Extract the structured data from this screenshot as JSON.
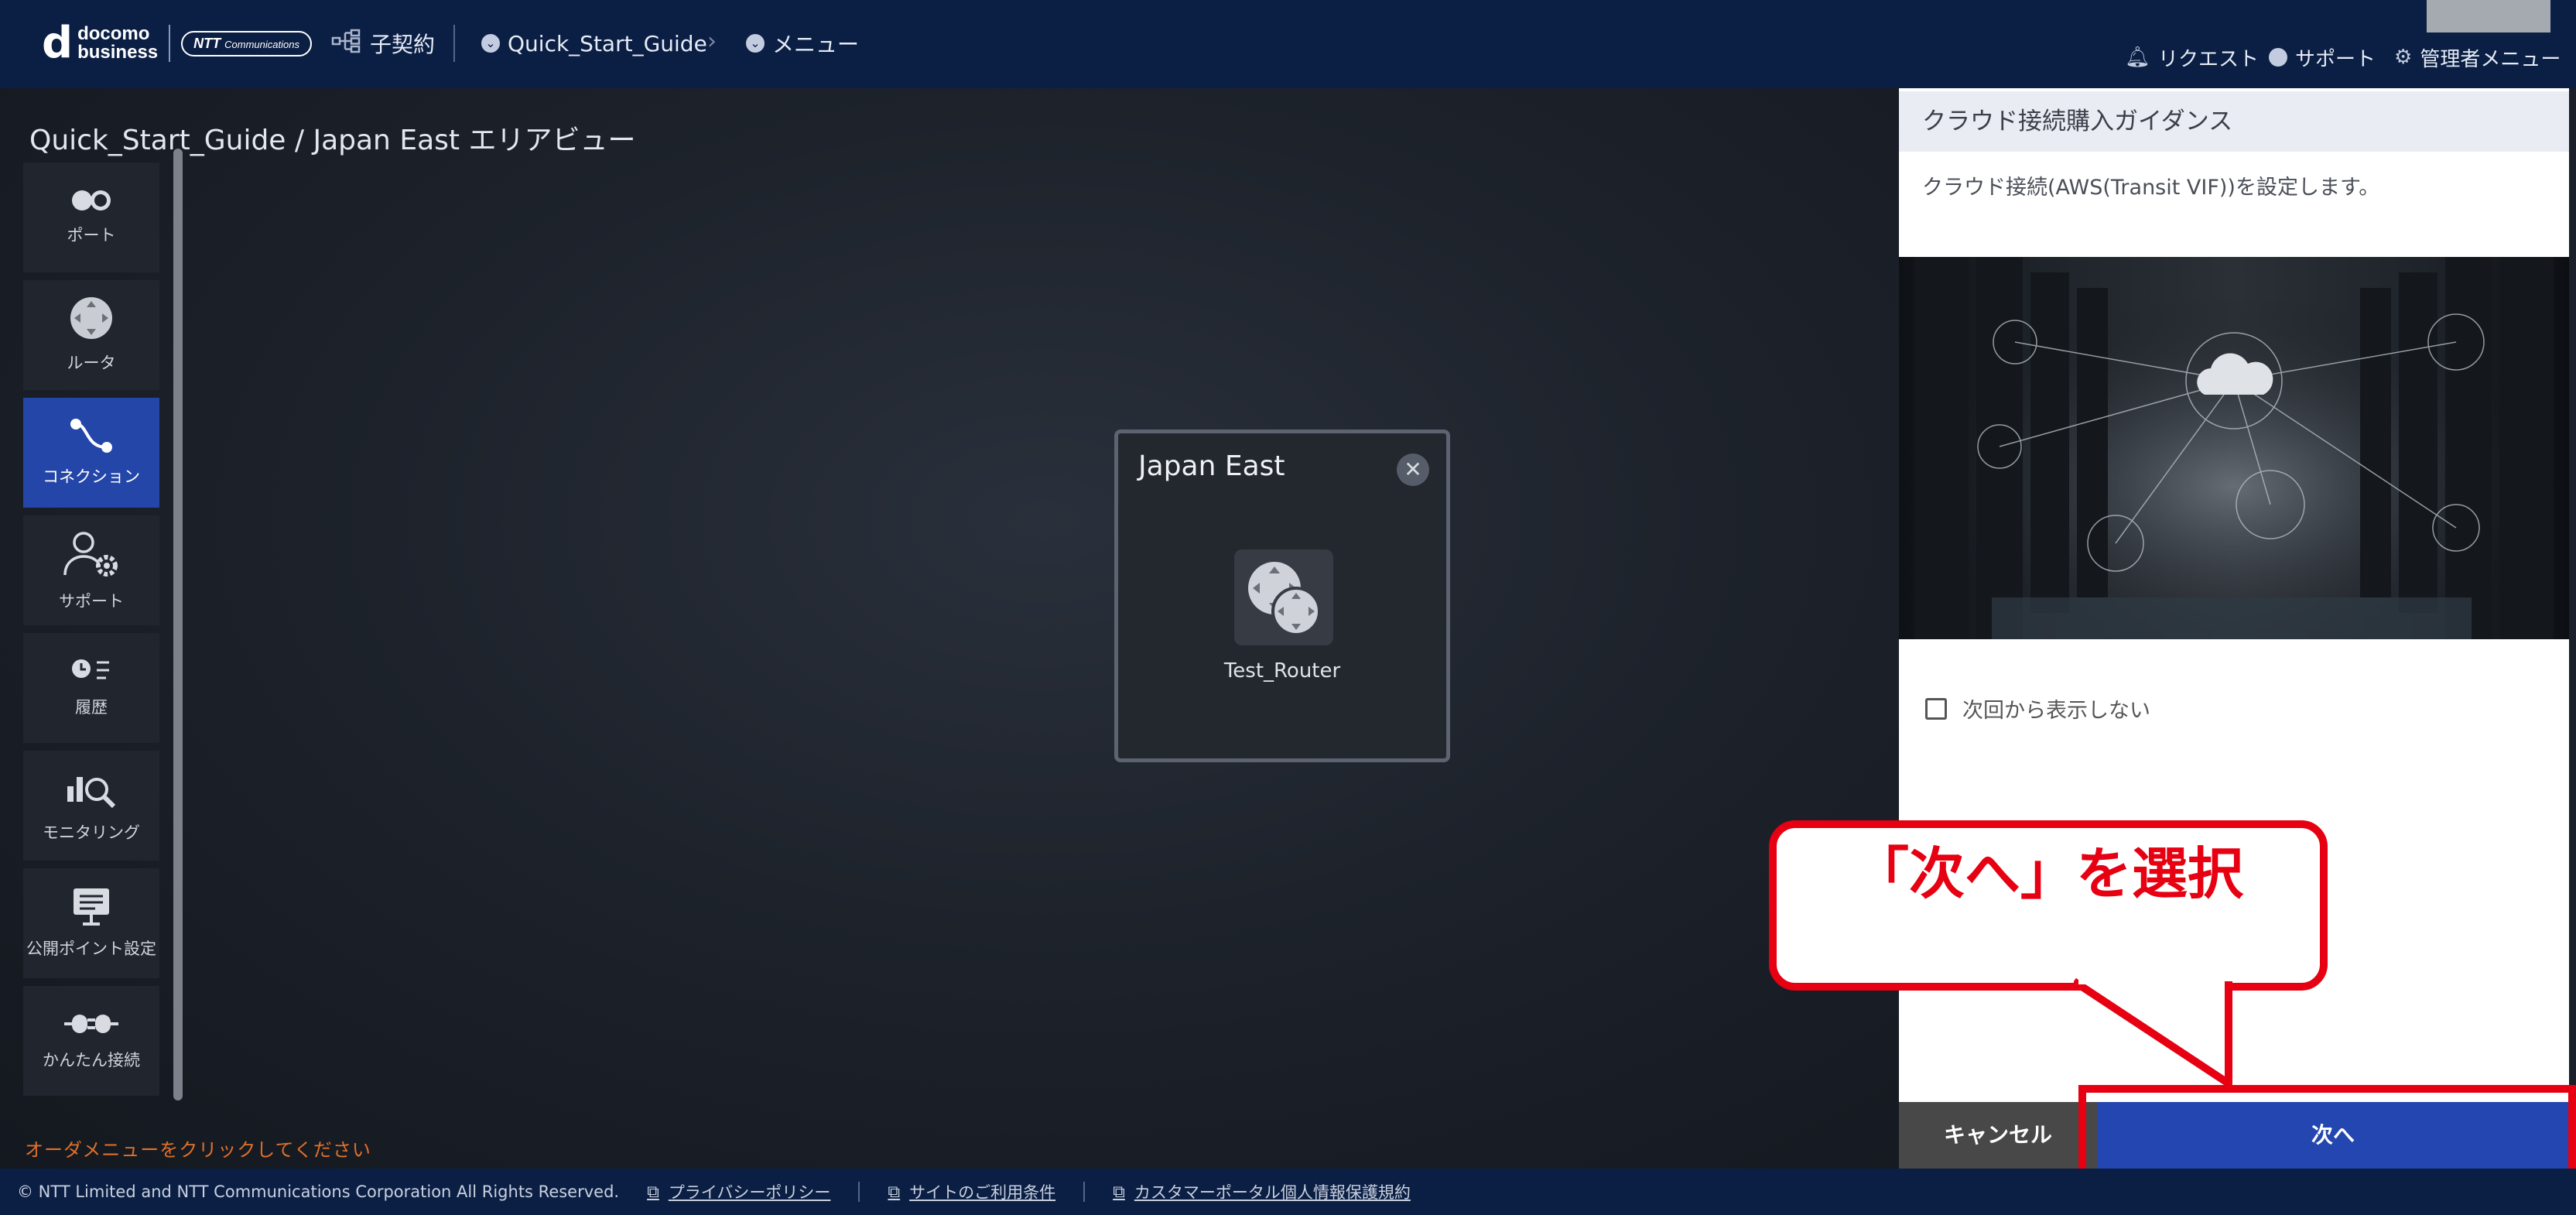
{
  "header": {
    "logo_top": "docomo",
    "logo_bottom": "business",
    "ntt_text": "NTT",
    "ntt_sub": "Communications",
    "contract_label": "子契約",
    "breadcrumb": {
      "project": "Quick_Start_Guide",
      "menu": "メニュー"
    },
    "right_links": {
      "request": "リクエスト",
      "support": "サポート",
      "admin": "管理者メニュー"
    }
  },
  "main": {
    "page_title": "Quick_Start_Guide / Japan East エリアビュー",
    "sidebar": [
      {
        "label": "ポート",
        "icon": "port-icon"
      },
      {
        "label": "ルータ",
        "icon": "router-icon"
      },
      {
        "label": "コネクション",
        "icon": "connection-icon",
        "active": true
      },
      {
        "label": "サポート",
        "icon": "support-icon"
      },
      {
        "label": "履歴",
        "icon": "history-icon"
      },
      {
        "label": "モニタリング",
        "icon": "monitoring-icon"
      },
      {
        "label": "公開ポイント設定",
        "icon": "public-point-icon"
      },
      {
        "label": "かんたん接続",
        "icon": "easy-connect-icon"
      }
    ],
    "order_hint": "オーダメニューをクリックしてください",
    "area": {
      "title": "Japan East",
      "close": "✕",
      "router_name": "Test_Router"
    }
  },
  "panel": {
    "title": "クラウド接続購入ガイダンス",
    "description": "クラウド接続(AWS(Transit VIF))を設定します。",
    "dont_show_label": "次回から表示しない",
    "cancel_label": "キャンセル",
    "next_label": "次へ"
  },
  "annotation": {
    "callout_text": "「次へ」を選択",
    "accent_color": "#e60012"
  },
  "footer": {
    "copyright": "© NTT Limited and NTT Communications Corporation All Rights Reserved.",
    "links": [
      "プライバシーポリシー",
      "サイトのご利用条件",
      "カスタマーポータル個人情報保護規約"
    ]
  },
  "colors": {
    "header_bg": "#0b1f44",
    "active_blue": "#2446a8",
    "next_button": "#2446b0",
    "cancel_button": "#484848",
    "hint_orange": "#e0702a"
  }
}
